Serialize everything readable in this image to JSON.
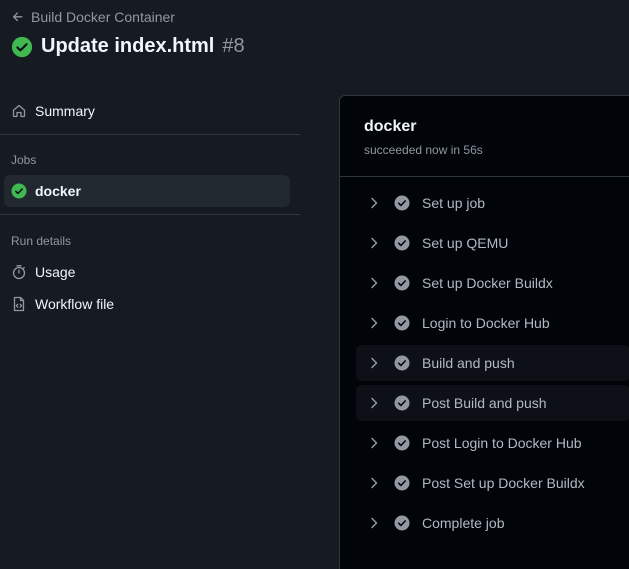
{
  "header": {
    "back_label": "Build Docker Container",
    "title": "Update index.html",
    "run_number": "#8"
  },
  "sidebar": {
    "summary_label": "Summary",
    "jobs_heading": "Jobs",
    "jobs": [
      {
        "label": "docker",
        "status": "success"
      }
    ],
    "run_details_heading": "Run details",
    "usage_label": "Usage",
    "workflow_file_label": "Workflow file"
  },
  "job": {
    "name": "docker",
    "status_text": "succeeded now in 56s",
    "steps": [
      {
        "label": "Set up job",
        "status": "success"
      },
      {
        "label": "Set up QEMU",
        "status": "success"
      },
      {
        "label": "Set up Docker Buildx",
        "status": "success"
      },
      {
        "label": "Login to Docker Hub",
        "status": "success"
      },
      {
        "label": "Build and push",
        "status": "success"
      },
      {
        "label": "Post Build and push",
        "status": "success"
      },
      {
        "label": "Post Login to Docker Hub",
        "status": "success"
      },
      {
        "label": "Post Set up Docker Buildx",
        "status": "success"
      },
      {
        "label": "Complete job",
        "status": "success"
      }
    ]
  },
  "colors": {
    "success": "#3fb950",
    "step_check": "#9198a1",
    "background": "#161b22",
    "panel": "#010409"
  }
}
